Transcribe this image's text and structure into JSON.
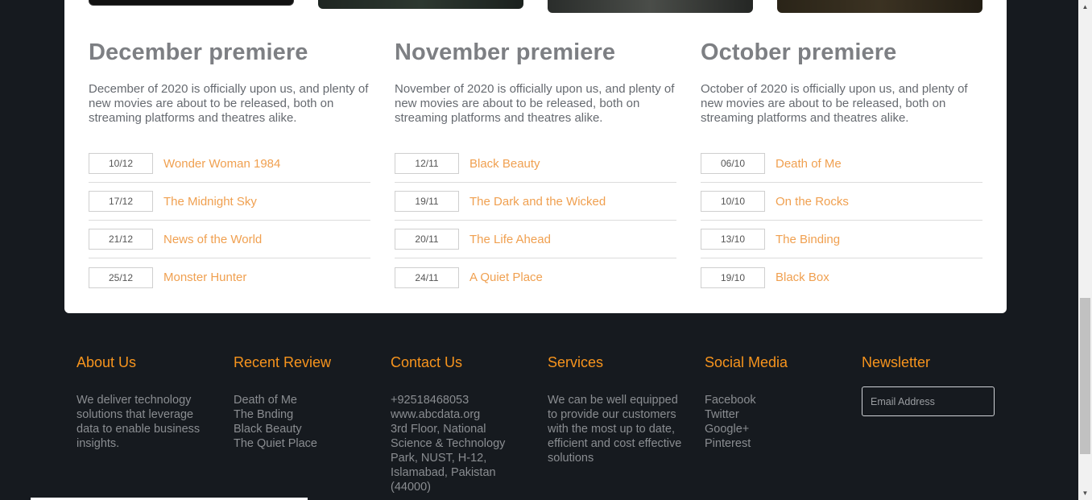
{
  "premieres": [
    {
      "title": "December premiere",
      "description": "December of 2020 is officially upon us, and plenty of new movies are about to be released, both on streaming platforms and theatres alike.",
      "movies": [
        {
          "date": "10/12",
          "title": "Wonder Woman 1984"
        },
        {
          "date": "17/12",
          "title": "The Midnight Sky"
        },
        {
          "date": "21/12",
          "title": "News of the World"
        },
        {
          "date": "25/12",
          "title": "Monster Hunter"
        }
      ]
    },
    {
      "title": "November premiere",
      "description": "November of 2020 is officially upon us, and plenty of new movies are about to be released, both on streaming platforms and theatres alike.",
      "movies": [
        {
          "date": "12/11",
          "title": "Black Beauty"
        },
        {
          "date": "19/11",
          "title": "The Dark and the Wicked"
        },
        {
          "date": "20/11",
          "title": "The Life Ahead"
        },
        {
          "date": "24/11",
          "title": "A Quiet Place"
        }
      ]
    },
    {
      "title": "October premiere",
      "description": "October of 2020 is officially upon us, and plenty of new movies are about to be released, both on streaming platforms and theatres alike.",
      "movies": [
        {
          "date": "06/10",
          "title": "Death of Me"
        },
        {
          "date": "10/10",
          "title": "On the Rocks"
        },
        {
          "date": "13/10",
          "title": "The Binding"
        },
        {
          "date": "19/10",
          "title": "Black Box"
        }
      ]
    }
  ],
  "footer": {
    "about": {
      "heading": "About Us",
      "text": "We deliver technology solutions that leverage data to enable business insights."
    },
    "recent_review": {
      "heading": "Recent Review",
      "items": [
        "Death of Me",
        "The Bnding",
        "Black Beauty",
        "The Quiet Place"
      ]
    },
    "contact": {
      "heading": "Contact Us",
      "phone": "+92518468053",
      "website": "www.abcdata.org",
      "address": "3rd Floor, National Science & Technology Park, NUST, H-12, Islamabad, Pakistan (44000)"
    },
    "services": {
      "heading": "Services",
      "text": "We can be well equipped to provide our customers with the most up to date, efficient and cost effective solutions"
    },
    "social": {
      "heading": "Social Media",
      "items": [
        "Facebook",
        "Twitter",
        "Google+",
        "Pinterest"
      ]
    },
    "newsletter": {
      "heading": "Newsletter",
      "placeholder": "Email Address"
    }
  },
  "colors": {
    "accent": "#f7941d",
    "movie_link": "#f0a050",
    "footer_bg": "#161a1f",
    "card_bg": "#ffffff"
  },
  "icons": {
    "scroll_up": "scroll-up-arrow-icon",
    "scroll_down": "scroll-down-arrow-icon"
  }
}
